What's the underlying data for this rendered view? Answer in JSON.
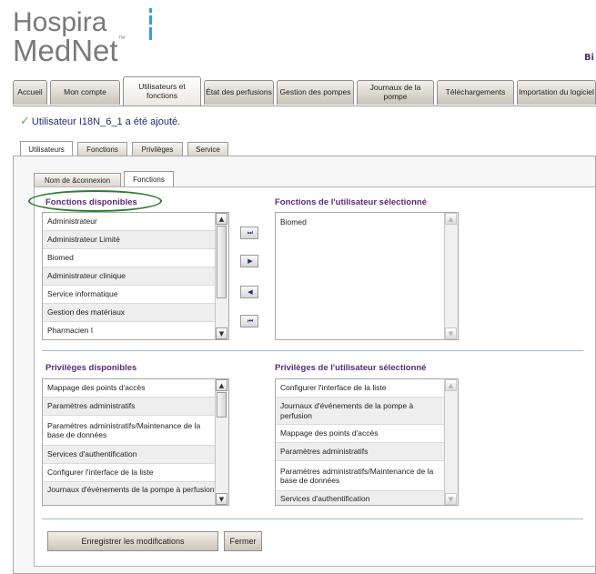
{
  "branding": {
    "logo_line1": "Hospira",
    "logo_line2": "MedNet",
    "trademark": "™",
    "corner_text": "Bi"
  },
  "nav": {
    "tabs": [
      {
        "label": "Accueil"
      },
      {
        "label": "Mon compte"
      },
      {
        "label": "Utilisateurs et fonctions"
      },
      {
        "label": "État des perfusions"
      },
      {
        "label": "Gestion des pompes"
      },
      {
        "label": "Journaux de la pompe"
      },
      {
        "label": "Téléchargements"
      },
      {
        "label": "Importation du logiciel"
      }
    ],
    "active_index": 2
  },
  "message": {
    "check": "✓",
    "text": "Utilisateur I18N_6_1 a été ajouté."
  },
  "subtabs": [
    {
      "label": "Utilisateurs"
    },
    {
      "label": "Fonctions"
    },
    {
      "label": "Privilèges"
    },
    {
      "label": "Service"
    }
  ],
  "inner_tabs": [
    {
      "label": "Nom de &connexion"
    },
    {
      "label": "Fonctions"
    }
  ],
  "functions": {
    "available_title": "Fonctions disponibles",
    "available": [
      "Administrateur",
      "Administrateur Limité",
      "Biomed",
      "Administrateur clinique",
      "Service informatique",
      "Gestion des matériaux",
      "Pharmacien I"
    ],
    "selected_title": "Fonctions de l'utilisateur sélectionné",
    "selected": [
      "Biomed"
    ]
  },
  "move_buttons": {
    "add_all": "⏭",
    "add": "▶",
    "remove": "◀",
    "remove_all": "⏮"
  },
  "privileges": {
    "available_title": "Privilèges disponibles",
    "available": [
      "Mappage des points d'accès",
      "Paramètres administratifs",
      "Paramètres administratifs/Maintenance de la base de données",
      "Services d'authentification",
      "Configurer l'interface de la liste",
      "Journaux d'événements de la pompe à perfusion"
    ],
    "selected_title": "Privilèges de l'utilisateur sélectionné",
    "selected": [
      "Configurer l'interface de la liste",
      "Journaux d'événements de la pompe à perfusion",
      "Mappage des points d'accès",
      "Paramètres administratifs",
      "Paramètres administratifs/Maintenance de la base de données",
      "Services d'authentification"
    ]
  },
  "actions": {
    "save": "Enregistrer les modifications",
    "close": "Fermer"
  },
  "scroll_glyphs": {
    "up": "▲",
    "down": "▼"
  },
  "colors": {
    "accent_purple": "#5a2a7a",
    "logo_blue": "#2aa3e0",
    "check_green": "#56b04a",
    "highlight_oval": "#2e7d32"
  }
}
